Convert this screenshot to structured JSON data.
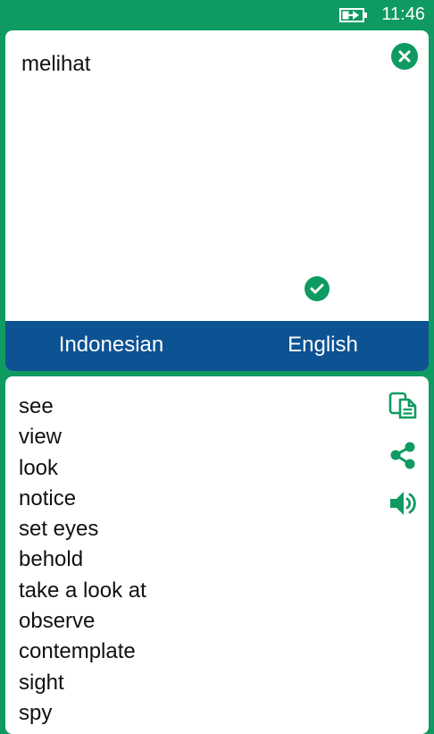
{
  "status_bar": {
    "time": "11:46",
    "battery_icon": "battery-charging-icon"
  },
  "input": {
    "text": "melihat",
    "clear_icon": "close-circle-icon"
  },
  "languages": {
    "source": "Indonesian",
    "target": "English",
    "selected": "English"
  },
  "results": [
    "see",
    "view",
    "look",
    "notice",
    "set eyes",
    "behold",
    "take a look at",
    "observe",
    "contemplate",
    "sight",
    "spy"
  ],
  "actions": {
    "copy_icon": "copy-icon",
    "share_icon": "share-icon",
    "speak_icon": "speaker-icon"
  },
  "colors": {
    "accent": "#0f9a62",
    "language_bar": "#0d5292",
    "card": "#ffffff"
  }
}
